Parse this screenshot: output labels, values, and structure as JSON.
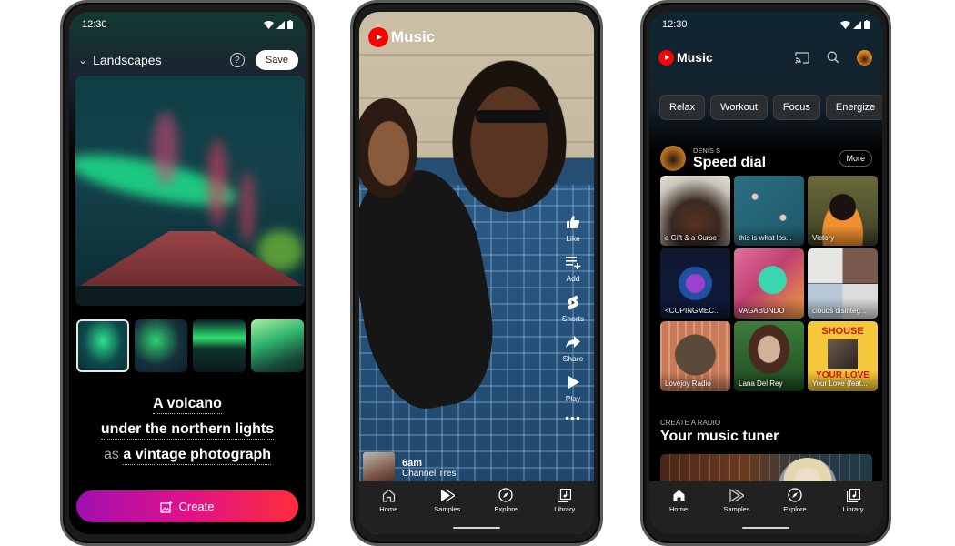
{
  "phone1": {
    "status": {
      "time": "12:30"
    },
    "header": {
      "category": "Landscapes",
      "help_icon": "question-circle-icon",
      "save_label": "Save"
    },
    "main_image_alt": "Red volcano under green and pink northern lights",
    "thumbnails": [
      {
        "alt": "Aurora over volcano variant 1",
        "selected": true
      },
      {
        "alt": "Aurora swirl variant 2",
        "selected": false
      },
      {
        "alt": "Aurora band over mountain variant 3",
        "selected": false
      },
      {
        "alt": "Bright aurora over green mountain variant 4",
        "selected": false
      }
    ],
    "prompt": {
      "line1": "A volcano",
      "line2": "under the northern lights",
      "line3_prefix": "as",
      "line3_style": "a vintage photograph"
    },
    "create_label": "Create",
    "colors": {
      "create_gradient_start": "#a10fb0",
      "create_gradient_mid": "#e0118a",
      "create_gradient_end": "#ff2d3a"
    }
  },
  "phone2": {
    "brand": "Music",
    "actions": [
      {
        "label": "Like",
        "icon": "thumbs-up-icon"
      },
      {
        "label": "Add",
        "icon": "playlist-add-icon"
      },
      {
        "label": "Shorts",
        "icon": "shorts-icon"
      },
      {
        "label": "Share",
        "icon": "share-icon"
      },
      {
        "label": "Play",
        "icon": "play-icon"
      }
    ],
    "now_playing": {
      "title": "6am",
      "artist": "Channel Tres"
    },
    "nav": [
      {
        "label": "Home",
        "icon": "home-outline-icon"
      },
      {
        "label": "Samples",
        "icon": "samples-icon"
      },
      {
        "label": "Explore",
        "icon": "compass-icon"
      },
      {
        "label": "Library",
        "icon": "library-icon"
      }
    ]
  },
  "phone3": {
    "status": {
      "time": "12:30"
    },
    "brand": "Music",
    "header_icons": [
      "cast-icon",
      "search-icon",
      "avatar"
    ],
    "chips": [
      "Relax",
      "Workout",
      "Focus",
      "Energize"
    ],
    "speed_dial": {
      "user": "DENIS S",
      "title": "Speed dial",
      "more_label": "More",
      "tiles": [
        "a Gift & a Curse",
        "this is what los...",
        "Victory",
        "<COPINGMEC...",
        "VAGABUNDO",
        "clouds disinteg...",
        "Lovejoy Radio",
        "Lana Del Rey",
        "Your Love (feat..."
      ],
      "tile9_art_text": {
        "top": "SHOUSE",
        "bottom": "YOUR LOVE"
      }
    },
    "radio": {
      "subtitle": "CREATE A RADIO",
      "title": "Your music tuner"
    },
    "nav": [
      {
        "label": "Home",
        "icon": "home-filled-icon",
        "active": true
      },
      {
        "label": "Samples",
        "icon": "samples-icon"
      },
      {
        "label": "Explore",
        "icon": "compass-icon"
      },
      {
        "label": "Library",
        "icon": "library-icon"
      }
    ]
  },
  "colors": {
    "youtube_red": "#ff0000",
    "nav_bg": "#212121",
    "chip_bg": "#2b2e31",
    "shouse_yellow": "#f4c83a",
    "shouse_red": "#d4141c"
  }
}
